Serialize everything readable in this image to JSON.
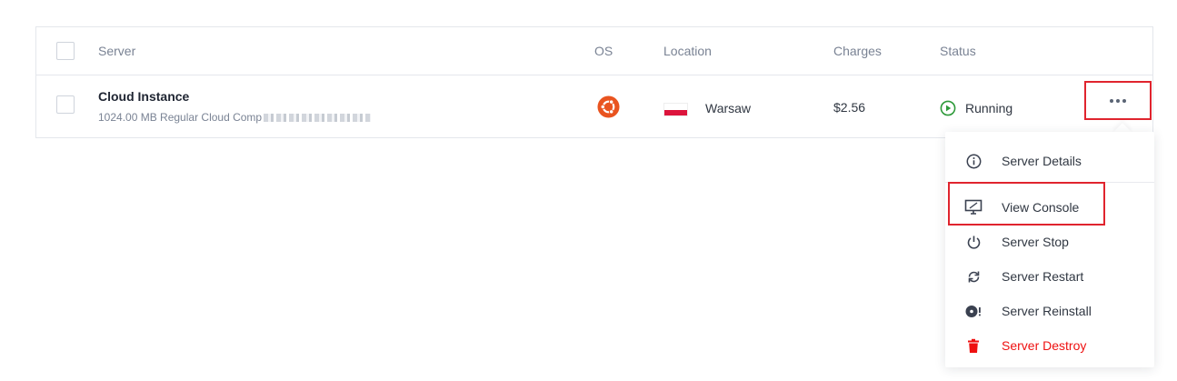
{
  "table": {
    "headers": {
      "server": "Server",
      "os": "OS",
      "location": "Location",
      "charges": "Charges",
      "status": "Status"
    },
    "row": {
      "name": "Cloud Instance",
      "description": "1024.00 MB Regular Cloud Comp",
      "os_icon": "ubuntu-icon",
      "location": "Warsaw",
      "flag": "poland-flag",
      "charges": "$2.56",
      "status": "Running",
      "status_color": "#2e9a3a"
    }
  },
  "menu": {
    "items": [
      {
        "label": "Server Details",
        "icon": "info-icon"
      },
      {
        "label": "View Console",
        "icon": "monitor-icon"
      },
      {
        "label": "Server Stop",
        "icon": "power-icon"
      },
      {
        "label": "Server Restart",
        "icon": "refresh-icon"
      },
      {
        "label": "Server Reinstall",
        "icon": "disc-icon"
      },
      {
        "label": "Server Destroy",
        "icon": "trash-icon",
        "color": "#ee1111"
      }
    ]
  },
  "colors": {
    "highlight": "#e0242e",
    "ubuntu": "#e95420"
  }
}
